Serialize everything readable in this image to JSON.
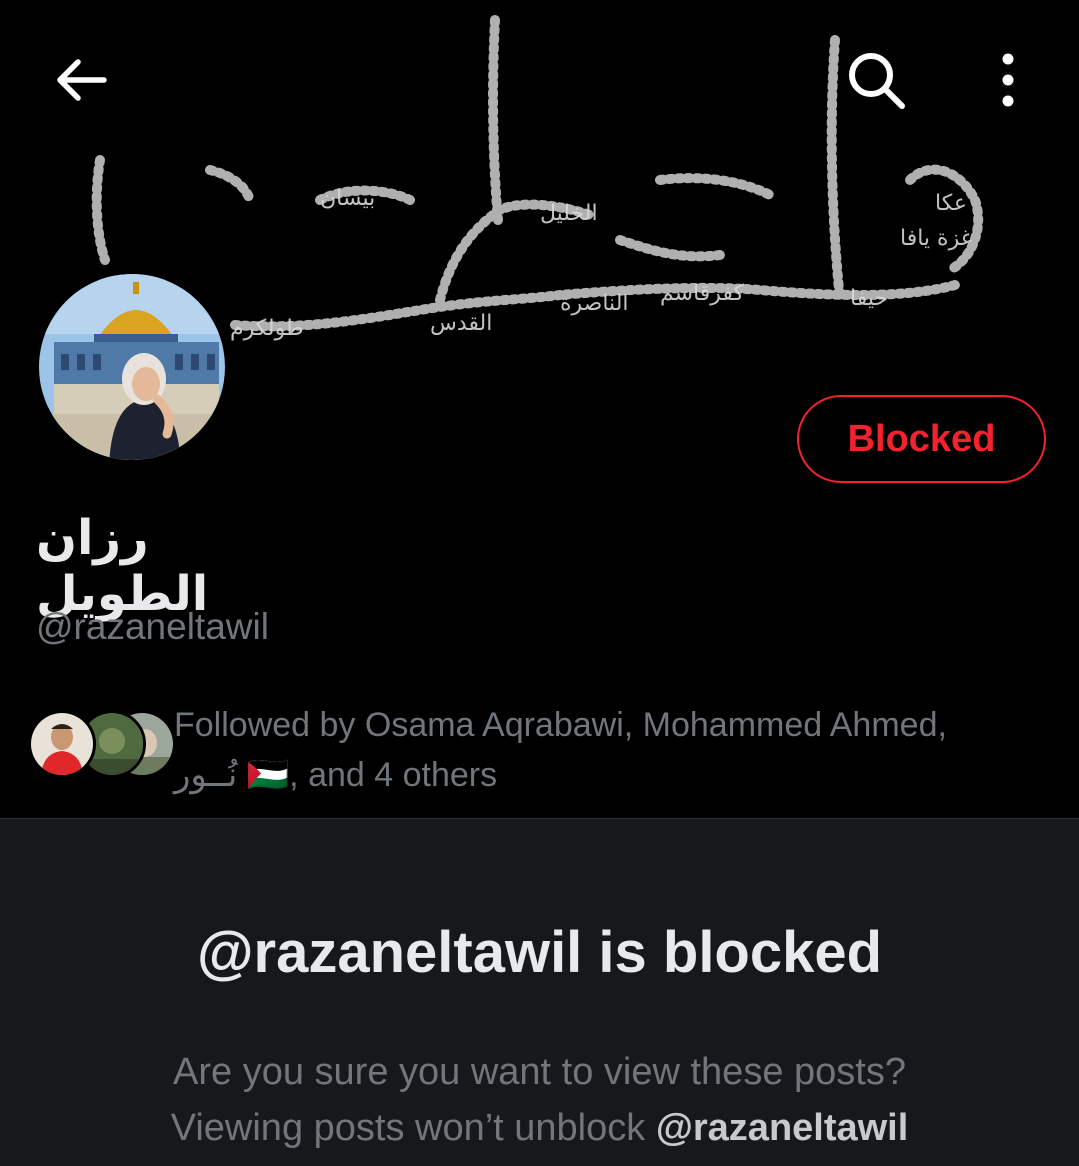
{
  "header": {
    "back_icon": "arrow-left-icon",
    "search_icon": "search-icon",
    "more_icon": "more-vertical-icon"
  },
  "profile": {
    "display_name": "رزان الطويل",
    "handle": "@razaneltawil",
    "relationship_button": "Blocked",
    "followed_by_prefix": "Followed by Osama Aqrabawi, Mohammed Ahmed,",
    "followed_by_second_line_name": "نُــور",
    "followed_by_flag": "🇵🇸",
    "followed_by_suffix": ", and 4 others"
  },
  "blocked_notice": {
    "title": "@razaneltawil is blocked",
    "line1": "Are you sure you want to view these posts?",
    "line2_prefix": "Viewing posts won’t unblock ",
    "line2_handle": "@razaneltawil"
  },
  "colors": {
    "background": "#000000",
    "panel": "#16181c",
    "blocked_red": "#f4212e",
    "muted_text": "#71767b"
  }
}
